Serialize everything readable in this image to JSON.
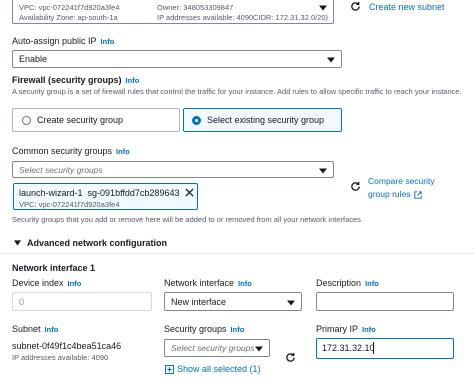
{
  "subnet_select": {
    "vpc": "VPC: vpc-072241f7d920a3fe4",
    "owner": "Owner: 348053309847",
    "az": "Availability Zone: ap-south-1a",
    "ips": "IP addresses available: 4090",
    "cidr": "CIDR: 172.31.32.0/20)"
  },
  "create_subnet_link": "Create new subnet",
  "auto_assign": {
    "label": "Auto-assign public IP",
    "info": "Info",
    "value": "Enable"
  },
  "firewall": {
    "title": "Firewall (security groups)",
    "info": "Info",
    "description": "A security group is a set of firewall rules that control the traffic for your instance. Add rules to allow specific traffic to reach your instance.",
    "option_create": "Create security group",
    "option_existing": "Select existing security group"
  },
  "common_sg": {
    "label": "Common security groups",
    "info": "Info",
    "placeholder": "Select security groups",
    "token_name": "launch-wizard-1",
    "token_id": "sg-091bffdd7cb289643",
    "token_vpc": "VPC: vpc-072241f7d920a3fe4",
    "compare_line1": "Compare security",
    "compare_line2": "group rules",
    "helper": "Security groups that you add or remove here will be added to or removed from all your network interfaces."
  },
  "advanced": {
    "title": "Advanced network configuration"
  },
  "network_interface": {
    "title": "Network interface 1",
    "device_index_label": "Device index",
    "device_index_info": "Info",
    "device_index_value": "0",
    "ni_label": "Network interface",
    "ni_info": "Info",
    "ni_value": "New interface",
    "desc_label": "Description",
    "desc_info": "Info",
    "desc_value": "",
    "subnet_label": "Subnet",
    "subnet_info": "Info",
    "subnet_value": "subnet-0f49f1c4bea51ca46",
    "subnet_ips": "IP addresses available: 4090",
    "sg_label": "Security groups",
    "sg_info": "Info",
    "sg_placeholder": "Select security groups",
    "show_all": "Show all selected (1)",
    "primary_ip_label": "Primary IP",
    "primary_ip_info": "Info",
    "primary_ip_value": "172.31.32.10"
  },
  "colors": {
    "link": "#0073bb",
    "selected_border": "#0073bb",
    "selected_bg": "#f1faff"
  }
}
